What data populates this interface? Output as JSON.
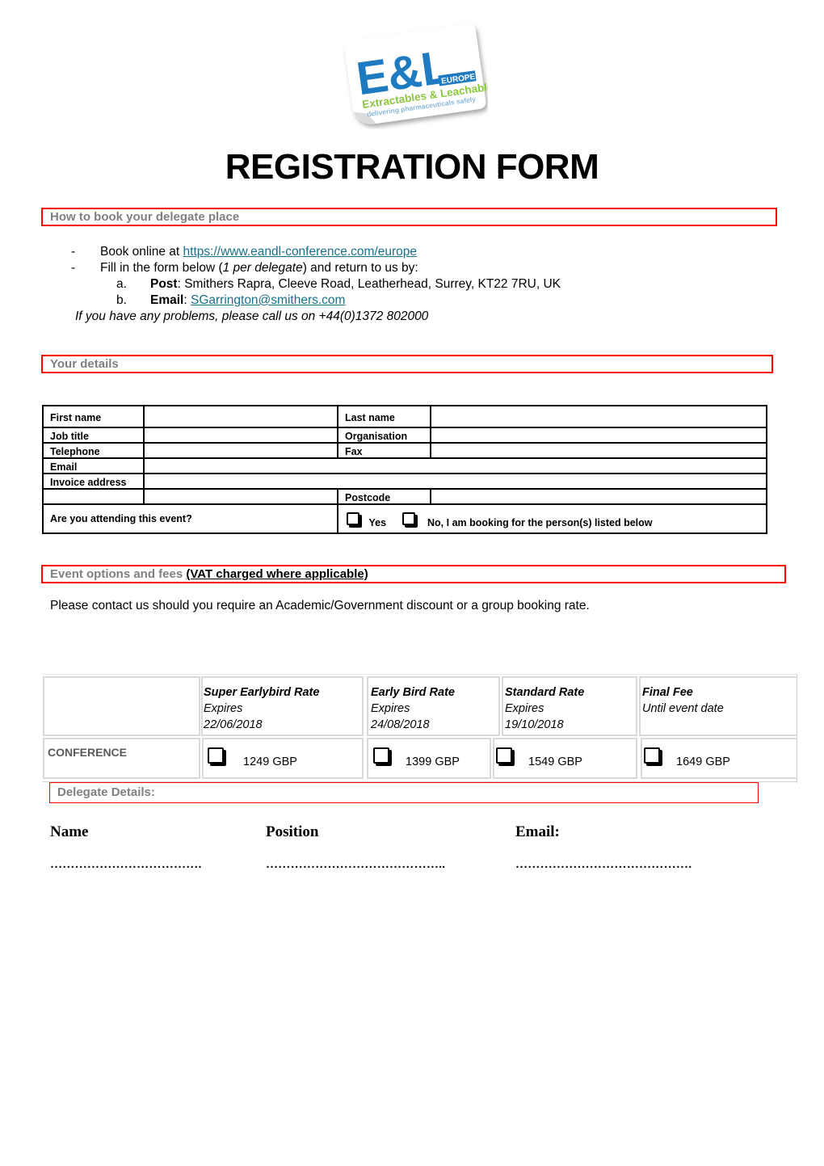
{
  "logo": {
    "main": "E&L",
    "badge": "EUROPE",
    "subtitle": "Extractables & Leachables",
    "tagline": "delivering pharmaceuticals safely",
    "colors": {
      "blue": "#1e7ac1",
      "green": "#8cc63f"
    }
  },
  "title": "REGISTRATION FORM",
  "how_to_book": {
    "heading": "How to book your delegate place",
    "book_online_prefix": "Book online at ",
    "book_online_url": "https://www.eandl-conference.com/europe",
    "fill_prefix": "Fill in the form below (",
    "fill_italic": "1 per delegate",
    "fill_suffix": ") and return to us by:",
    "post_marker": "a.",
    "post_label": "Post",
    "post_value": ": Smithers Rapra, Cleeve Road, Leatherhead, Surrey, KT22 7RU, UK",
    "email_marker": "b.",
    "email_label": "Email",
    "email_sep": ": ",
    "email_value": "SGarrington@smithers.com",
    "problems": "If you have any problems, please call us on +44(0)1372 802000",
    "bullet": "-"
  },
  "your_details": {
    "heading": "Your details",
    "fields": {
      "first_name": "First name",
      "last_name": "Last name",
      "job_title": "Job title",
      "organisation": "Organisation",
      "telephone": "Telephone",
      "fax": "Fax",
      "email": "Email",
      "invoice_address": "Invoice address",
      "postcode": "Postcode",
      "attending": "Are you attending this event?",
      "yes": "Yes",
      "no": "No, I am booking for the person(s) listed below"
    }
  },
  "event_options": {
    "heading": "Event options and fees ",
    "heading_vat": "(VAT charged where applicable)",
    "contact_note": "Please contact us should you require an Academic/Government discount or a group booking rate.",
    "row_label": "CONFERENCE",
    "rates": [
      {
        "name": "Super Earlybird Rate",
        "line2": "Expires",
        "line3": "22/06/2018",
        "price": "1249 GBP"
      },
      {
        "name": "Early Bird Rate",
        "line2": "Expires",
        "line3": "24/08/2018",
        "price": "1399 GBP"
      },
      {
        "name": "Standard Rate",
        "line2": "Expires",
        "line3": "19/10/2018",
        "price": "1549 GBP"
      },
      {
        "name": "Final Fee",
        "line2": "Until event date",
        "line3": "",
        "price": "1649  GBP"
      }
    ]
  },
  "delegate_details": {
    "heading": "Delegate Details:",
    "name_label": "Name",
    "position_label": "Position",
    "email_label": "Email:",
    "name_dots": "……………………………….",
    "position_dots": "……………………………………..",
    "email_dots": "……………………………………."
  },
  "colors": {
    "section_border": "#ff0000",
    "section_text": "#808080",
    "link": "#1a6f8a"
  }
}
